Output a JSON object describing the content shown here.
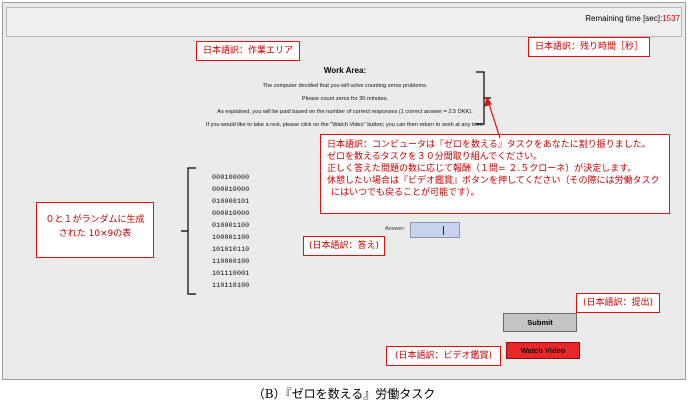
{
  "header": {
    "remaining_label": "Remaining time [sec]:",
    "remaining_value": "1537"
  },
  "annotations": {
    "work_area": "日本語訳：作業エリア",
    "remaining_time": "日本語訳：残り時間［秒］",
    "instructions": [
      "日本語訳：コンピュータは『ゼロを数える』タスクをあなたに割り振りました。",
      "ゼロを数えるタスクを３０分間取り組んでください。",
      "正しく答えた問題の数に応じて報酬（１問= ２.５クローネ）が決定します。",
      "休憩したい場合は『ビデオ鑑賞』ボタンを押してください（その際には労働タスク",
      "にはいつでも戻ることが可能です）。"
    ],
    "table": [
      "０と１がランダムに生成",
      "された 10×9の表"
    ],
    "answer": "(日本語訳：答え)",
    "submit": "(日本語訳：提出)",
    "watch_video": "(日本語訳：ビデオ鑑賞)"
  },
  "work_area": {
    "title": "Work Area:",
    "lines": [
      "The computer decided that you will solve counting zeros problems.",
      "Please count zeros for 30 minutes.",
      "As explained, you will be paid based on the number of correct responses (1 correct answer = 2.5 DKK).",
      "If you would like to take a rest, please click on the \"Watch Video\" button; you can then return to work at any time."
    ]
  },
  "grid": {
    "rows": [
      "000100000",
      "000010000",
      "010000101",
      "000010000",
      "010001100",
      "100001100",
      "101010110",
      "110000100",
      "101110001",
      "110110100"
    ]
  },
  "answer": {
    "label": "Answer:",
    "value": ""
  },
  "buttons": {
    "submit": "Submit",
    "watch_video": "Watch Video"
  },
  "caption": "（B）『ゼロを数える』労働タスク",
  "colors": {
    "annotation_red": "#e01010",
    "watch_button": "#e82828",
    "remaining_value": "#d00000"
  }
}
